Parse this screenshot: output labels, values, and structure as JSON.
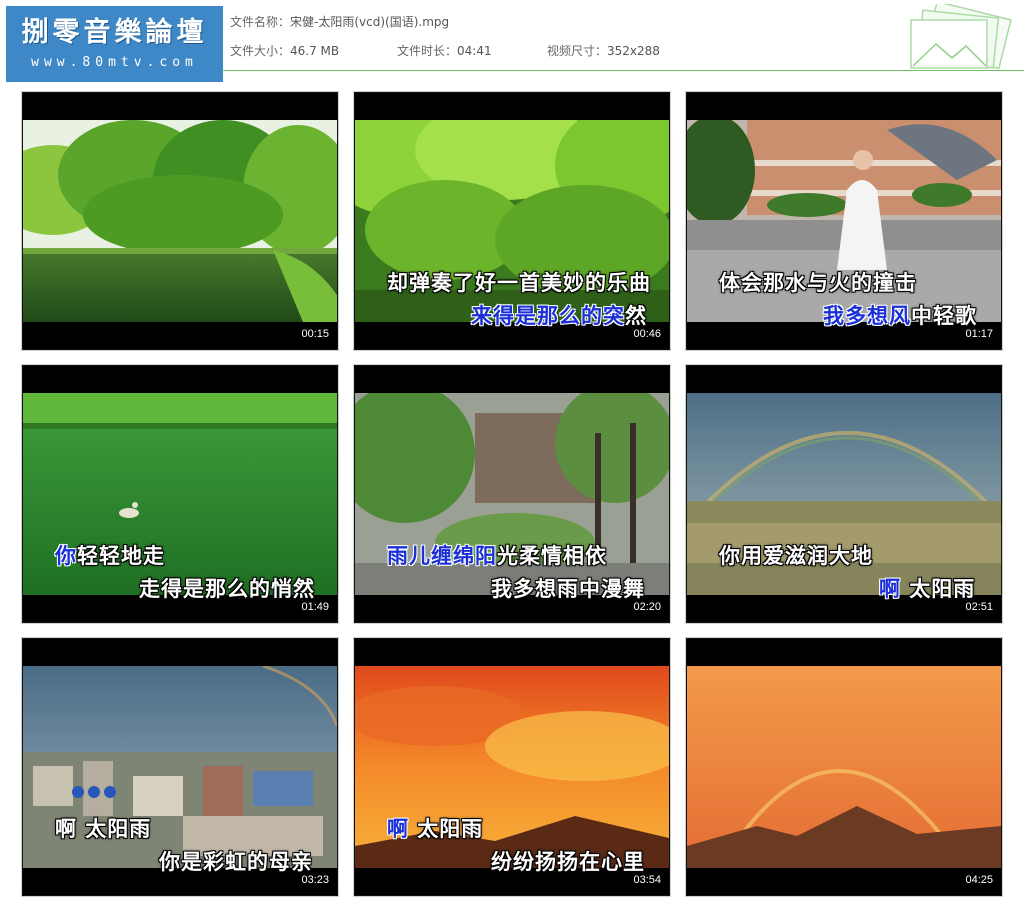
{
  "header": {
    "logo_text": "捌零音樂論壇",
    "logo_url": "www.80mtv.com",
    "file_name_label": "文件名称：",
    "file_name": "宋健-太阳雨(vcd)(国语).mpg",
    "file_size_label": "文件大小：",
    "file_size": "46.7 MB",
    "duration_label": "文件时长：",
    "duration": "04:41",
    "dimensions_label": "视频尺寸：",
    "dimensions": "352x288"
  },
  "thumbnails": [
    {
      "time": "00:15",
      "line1": "",
      "line1_hl": "",
      "line2": "",
      "line2_hl": ""
    },
    {
      "time": "00:46",
      "line1": "却弹奏了好一首美妙的乐曲",
      "line1_hl": "",
      "line2": "然",
      "line2_hl": "来得是那么的突"
    },
    {
      "time": "01:17",
      "line1": "体会那水与火的撞击",
      "line1_hl": "",
      "line2": "中轻歌",
      "line2_hl": "我多想风"
    },
    {
      "time": "01:49",
      "line1": "轻轻地走",
      "line1_hl": "你",
      "line2": "走得是那么的悄然",
      "line2_hl": ""
    },
    {
      "time": "02:20",
      "line1": "光柔情相依",
      "line1_hl": "雨儿缠绵阳",
      "line2": "我多想雨中漫舞",
      "line2_hl": ""
    },
    {
      "time": "02:51",
      "line1": "你用爱滋润大地",
      "line1_hl": "",
      "line2": " 太阳雨",
      "line2_hl": "啊"
    },
    {
      "time": "03:23",
      "line1": "啊 太阳雨",
      "line1_hl": "",
      "line2": "你是彩虹的母亲",
      "line2_hl": ""
    },
    {
      "time": "03:54",
      "line1": " 太阳雨",
      "line1_hl": "啊",
      "line2": "纷纷扬扬在心里",
      "line2_hl": ""
    },
    {
      "time": "04:25",
      "line1": "",
      "line1_hl": "",
      "line2": "",
      "line2_hl": ""
    }
  ]
}
